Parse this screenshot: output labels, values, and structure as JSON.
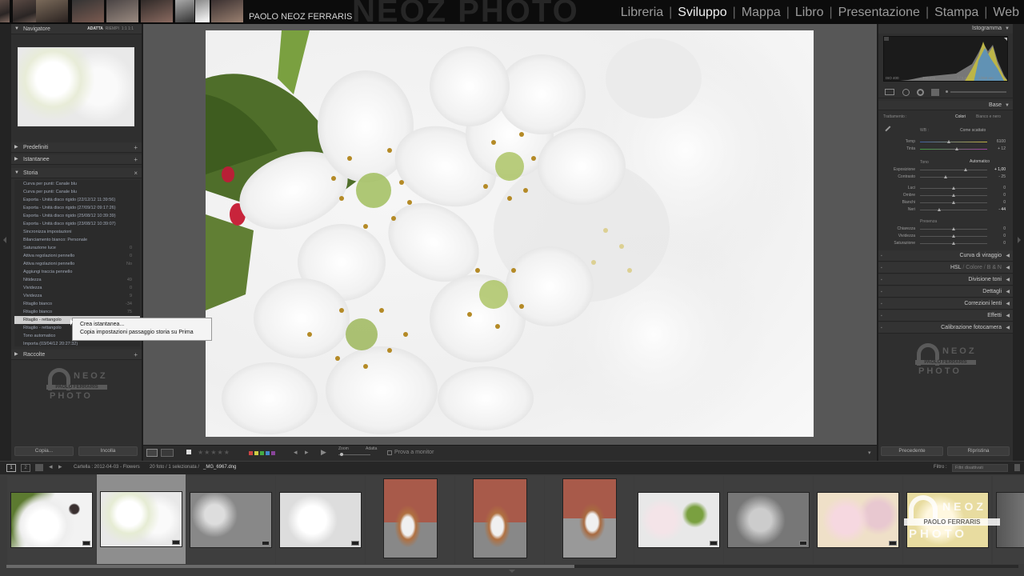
{
  "topbar": {
    "identity": "PAOLO NEOZ FERRARIS",
    "watermark": "NEOZ PHOTO",
    "modules": [
      {
        "label": "Libreria",
        "active": false
      },
      {
        "label": "Sviluppo",
        "active": true
      },
      {
        "label": "Mappa",
        "active": false
      },
      {
        "label": "Libro",
        "active": false
      },
      {
        "label": "Presentazione",
        "active": false
      },
      {
        "label": "Stampa",
        "active": false
      },
      {
        "label": "Web",
        "active": false
      }
    ]
  },
  "left": {
    "navigator": {
      "title": "Navigatore",
      "options": [
        "ADATTA",
        "RIEMPI",
        "1:1",
        "1:1"
      ]
    },
    "presets": "Predefiniti",
    "snapshots": "Istantanee",
    "history": {
      "title": "Storia",
      "items": [
        {
          "label": "Curva per punti: Canale blu",
          "value": ""
        },
        {
          "label": "Curva per punti: Canale blu",
          "value": ""
        },
        {
          "label": "Esporta - Unità disco rigido (22/12/12 11:39:56)",
          "value": ""
        },
        {
          "label": "Esporta - Unità disco rigido (27/09/12 09:17:26)",
          "value": ""
        },
        {
          "label": "Esporta - Unità disco rigido (25/08/12 10:39:39)",
          "value": ""
        },
        {
          "label": "Esporta - Unità disco rigido (23/08/12 10:39:07)",
          "value": ""
        },
        {
          "label": "Sincronizza impostazioni",
          "value": ""
        },
        {
          "label": "Bilanciamento bianco: Personale",
          "value": ""
        },
        {
          "label": "Saturazione luce",
          "value": "0"
        },
        {
          "label": "Attiva regolazioni pennello",
          "value": "0"
        },
        {
          "label": "Attiva regolazioni pennello",
          "value": "No"
        },
        {
          "label": "Aggiungi traccia pennello",
          "value": ""
        },
        {
          "label": "Nitidezza",
          "value": "49"
        },
        {
          "label": "Vividezza",
          "value": "0"
        },
        {
          "label": "Vividezza",
          "value": "9"
        },
        {
          "label": "Ritaglio bianco",
          "value": "-34"
        },
        {
          "label": "Ritaglio bianco",
          "value": "75"
        },
        {
          "label": "Ritaglio - rettangolo",
          "value": ""
        },
        {
          "label": "Ritaglio - rettangolo",
          "value": ""
        },
        {
          "label": "Tono automatico",
          "value": ""
        },
        {
          "label": "Importa (03/04/12 20:27:32)",
          "value": ""
        }
      ],
      "selected_index": 17
    },
    "context_menu": [
      "Crea istantanea...",
      "Copia impostazioni passaggio storia su Prima"
    ],
    "collections": "Raccolte",
    "logo": {
      "line1": "NEOZ",
      "line2": "PAOLO FERRARIS",
      "line3": "PHOTO"
    },
    "copy_button": "Copia...",
    "paste_button": "Incolla"
  },
  "toolbar": {
    "zoom_label": "Zoom",
    "fit_label": "Adatta",
    "softproof_label": "Prova a monitor"
  },
  "right": {
    "histogram": {
      "title": "Istogramma",
      "iso": "ISO 400",
      "focal": "100 mm",
      "aperture": "f / 5,6",
      "shutter": "1/250 sec"
    },
    "basic": {
      "title": "Base",
      "treatment_label": "Trattamento :",
      "colors": "Colori",
      "bw": "Bianco e nero",
      "wb_label": "WB :",
      "wb_value": "Come scattato",
      "temp": {
        "label": "Temp",
        "value": "6100"
      },
      "tint": {
        "label": "Tinta",
        "value": "+ 12"
      },
      "tone_label": "Tono",
      "auto_label": "Automatico",
      "exposure": {
        "label": "Esposizione",
        "value": "+ 1,00"
      },
      "contrast": {
        "label": "Contrasto",
        "value": "- 25"
      },
      "highlights": {
        "label": "Luci",
        "value": "0"
      },
      "shadows": {
        "label": "Ombre",
        "value": "0"
      },
      "whites": {
        "label": "Bianchi",
        "value": "0"
      },
      "blacks": {
        "label": "Neri",
        "value": "- 44"
      },
      "presence_label": "Presenza",
      "clarity": {
        "label": "Chiarezza",
        "value": "0"
      },
      "vibrance": {
        "label": "Vividezza",
        "value": "0"
      },
      "saturation": {
        "label": "Saturazione",
        "value": "0"
      }
    },
    "sections": [
      "Curva di viraggio",
      "Divisione toni",
      "Dettagli",
      "Correzioni lenti",
      "Effetti",
      "Calibrazione fotocamera"
    ],
    "hsl": {
      "hsl": "HSL",
      "sep1": "/",
      "color": "Colore",
      "sep2": "/",
      "bw": "B & N"
    },
    "logo": {
      "line1": "NEOZ",
      "line2": "PAOLO FERRARIS",
      "line3": "PHOTO"
    },
    "prev_button": "Precedente",
    "reset_button": "Ripristina"
  },
  "filmbar": {
    "view1": "1",
    "view2": "2",
    "folder": "Cartella : 2012-04-03 - Flowers",
    "count": "20 foto / 1 selezionata /",
    "filename": "_MG_6967.dng",
    "filter_label": "Filtro :",
    "filter_value": "Filtri disattivati"
  },
  "filmstrip": {
    "logo": {
      "line1": "NEOZ",
      "line2": "PAOLO FERRARIS",
      "line3": "PHOTO"
    }
  },
  "colors": {
    "accent_active": "#f0f0f0",
    "panel": "#2f2f2f",
    "canvas": "#575757"
  }
}
